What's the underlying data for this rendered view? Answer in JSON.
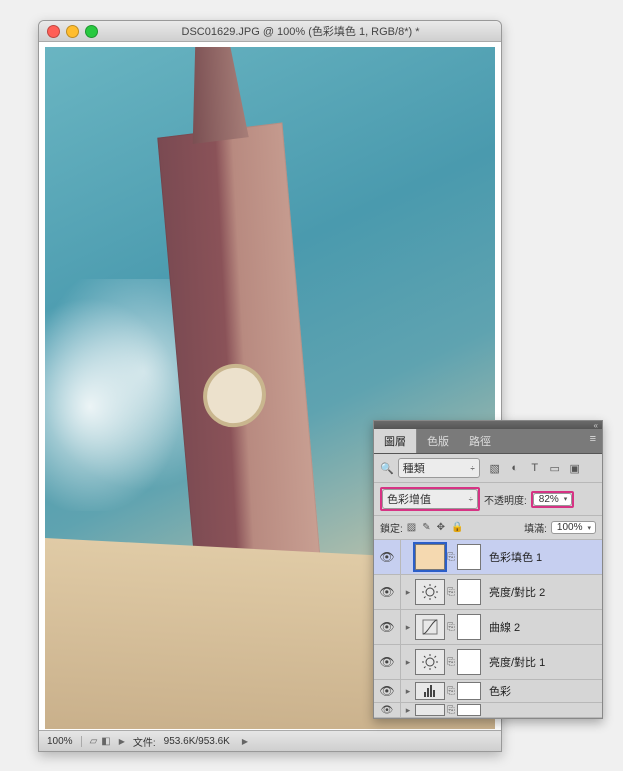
{
  "window": {
    "title": "DSC01629.JPG @ 100% (色彩填色 1, RGB/8*) *"
  },
  "statusbar": {
    "zoom": "100%",
    "file_label": "文件:",
    "file_value": "953.6K/953.6K"
  },
  "panel": {
    "tabs": [
      "圖層",
      "色版",
      "路徑"
    ],
    "active_tab": 0,
    "search": {
      "kind_label": "種類"
    },
    "blend": {
      "mode": "色彩增值"
    },
    "opacity": {
      "label": "不透明度:",
      "value": "82%"
    },
    "lock": {
      "label": "鎖定:"
    },
    "fill": {
      "label": "填滿:",
      "value": "100%"
    },
    "layers": [
      {
        "name": "色彩填色 1",
        "type": "fill",
        "selected": true
      },
      {
        "name": "亮度/對比 2",
        "type": "adj-bc"
      },
      {
        "name": "曲線 2",
        "type": "adj-curves"
      },
      {
        "name": "亮度/對比 1",
        "type": "adj-bc"
      },
      {
        "name": "色彩",
        "type": "adj-levels",
        "partial": true
      },
      {
        "name": "",
        "type": "adj-generic",
        "partial": true
      }
    ]
  }
}
